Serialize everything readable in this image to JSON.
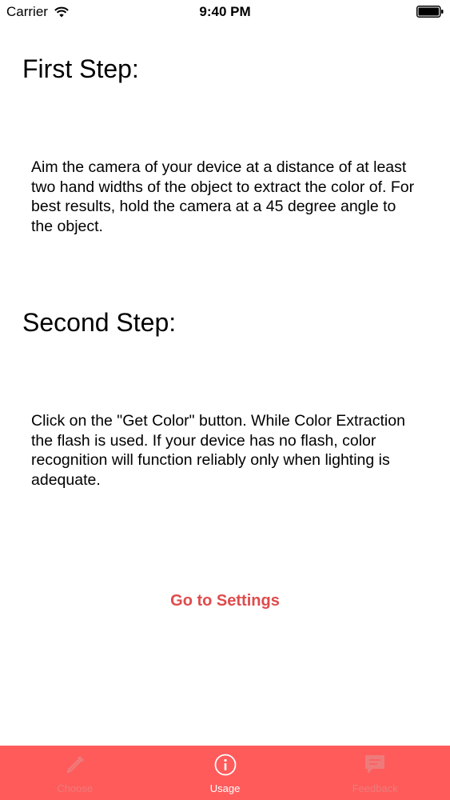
{
  "status_bar": {
    "carrier": "Carrier",
    "time": "9:40 PM"
  },
  "steps": [
    {
      "title": "First Step:",
      "text": "Aim the camera of your device at a distance of at least two hand widths of the object to extract the color of. For best results, hold the camera at a 45 degree angle to the object."
    },
    {
      "title": "Second Step:",
      "text": "Click on the \"Get Color\" button. While Color Extraction the flash is used. If your device has no flash, color recognition will function reliably only when lighting is adequate."
    }
  ],
  "settings_link": "Go to Settings",
  "tab_bar": {
    "tabs": [
      {
        "label": "Choose",
        "icon": "eyedropper-icon",
        "active": false
      },
      {
        "label": "Usage",
        "icon": "info-icon",
        "active": true
      },
      {
        "label": "Feedback",
        "icon": "speech-bubble-icon",
        "active": false
      }
    ]
  },
  "colors": {
    "accent": "#e04b4b",
    "tab_bar_background": "#ff5b5b",
    "tab_active": "#ffffff",
    "tab_inactive": "#ee7b7b"
  }
}
